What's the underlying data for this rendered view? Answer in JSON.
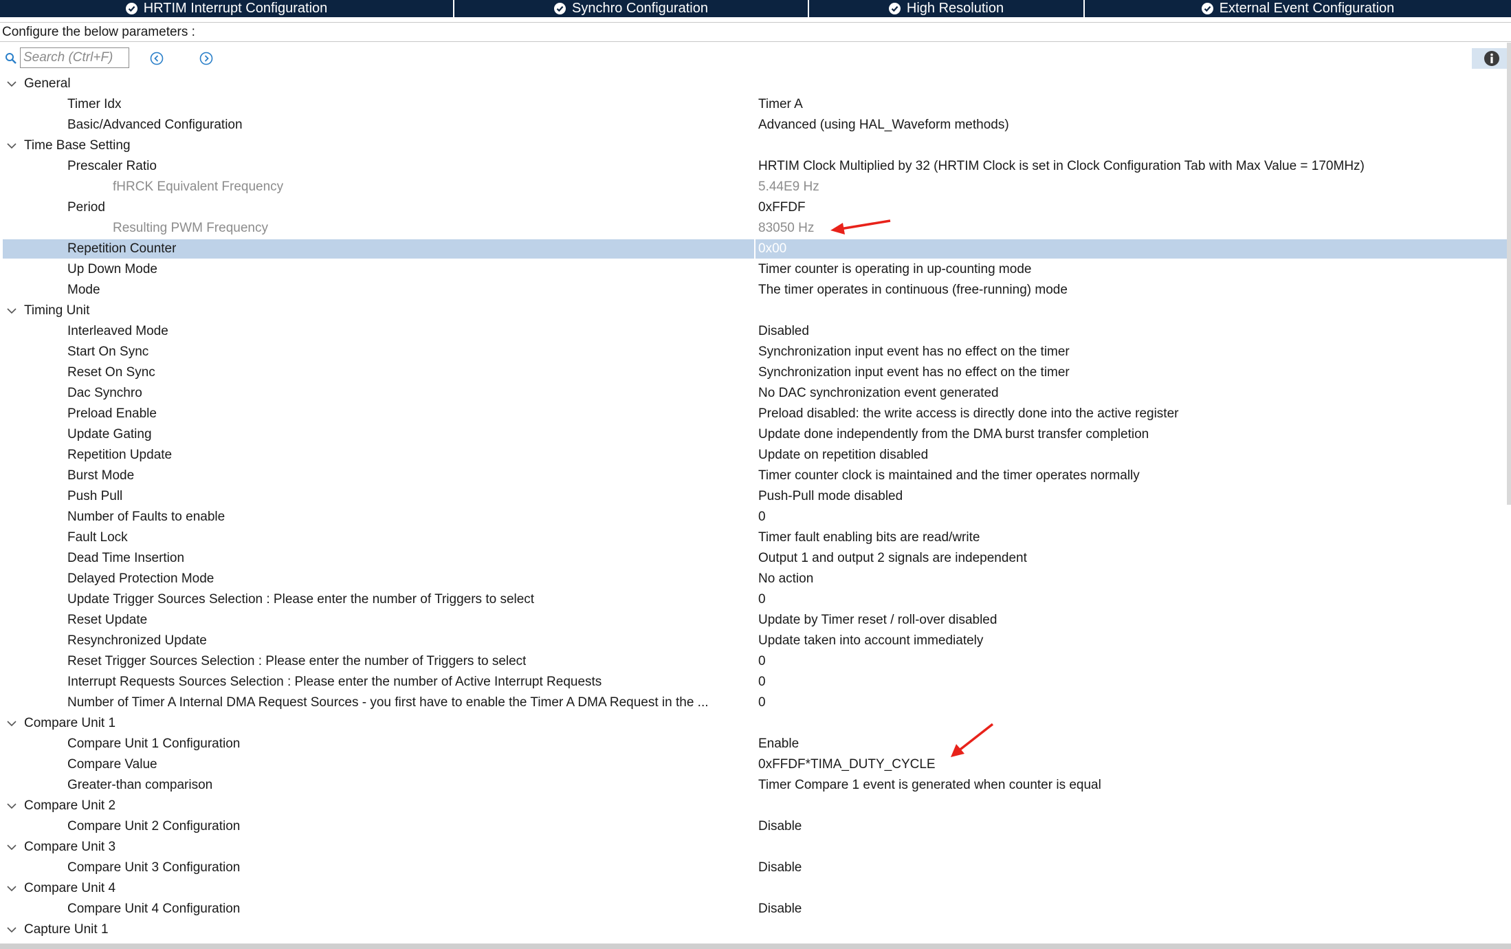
{
  "tabs": [
    {
      "label": "HRTIM Interrupt Configuration"
    },
    {
      "label": "Synchro Configuration"
    },
    {
      "label": "High Resolution"
    },
    {
      "label": "External Event Configuration"
    }
  ],
  "header": {
    "configure_label": "Configure the below parameters :"
  },
  "search": {
    "placeholder": "Search (Ctrl+F)"
  },
  "icons": {
    "tab_status": "check-circle-icon",
    "search": "search-icon",
    "prev": "chevron-left-circle-icon",
    "next": "chevron-right-circle-icon",
    "info": "info-icon",
    "category_toggle": "chevron-down-icon"
  },
  "colors": {
    "tab_background": "#0c2340",
    "selection": "#bed2e8",
    "dimmed_text": "#8c8c8c",
    "annotation_arrow": "#e8221a"
  },
  "tree": {
    "general": {
      "label": "General",
      "items": [
        {
          "label": "Timer Idx",
          "value": "Timer A"
        },
        {
          "label": "Basic/Advanced Configuration",
          "value": "Advanced (using HAL_Waveform methods)"
        }
      ]
    },
    "time_base": {
      "label": "Time Base Setting",
      "items": [
        {
          "label": "Prescaler Ratio",
          "value": "HRTIM Clock Multiplied by 32 (HRTIM Clock is set in Clock Configuration Tab with Max Value = 170MHz)"
        },
        {
          "label": "fHRCK Equivalent Frequency",
          "value": "5.44E9 Hz"
        },
        {
          "label": "Period",
          "value": "0xFFDF"
        },
        {
          "label": "Resulting PWM Frequency",
          "value": "83050 Hz"
        },
        {
          "label": "Repetition Counter",
          "value": "0x00"
        },
        {
          "label": "Up Down Mode",
          "value": "Timer counter is operating in up-counting mode"
        },
        {
          "label": "Mode",
          "value": "The timer operates in continuous (free-running) mode"
        }
      ]
    },
    "timing_unit": {
      "label": "Timing Unit",
      "items": [
        {
          "label": "Interleaved Mode",
          "value": "Disabled"
        },
        {
          "label": "Start On Sync",
          "value": "Synchronization input event has no effect on the timer"
        },
        {
          "label": "Reset On Sync",
          "value": "Synchronization input event has no effect on the timer"
        },
        {
          "label": "Dac Synchro",
          "value": "No DAC synchronization event generated"
        },
        {
          "label": "Preload Enable",
          "value": "Preload disabled: the write access is directly done into the active register"
        },
        {
          "label": "Update Gating",
          "value": "Update done independently from the DMA burst transfer completion"
        },
        {
          "label": "Repetition Update",
          "value": "Update on repetition disabled"
        },
        {
          "label": "Burst Mode",
          "value": "Timer counter clock is maintained and the timer operates normally"
        },
        {
          "label": "Push Pull",
          "value": "Push-Pull mode disabled"
        },
        {
          "label": "Number of Faults to enable",
          "value": "0"
        },
        {
          "label": "Fault Lock",
          "value": "Timer fault enabling bits are read/write"
        },
        {
          "label": "Dead Time Insertion",
          "value": "Output 1 and output 2 signals are independent"
        },
        {
          "label": "Delayed Protection Mode",
          "value": "No action"
        },
        {
          "label": "Update Trigger Sources Selection : Please enter the number of Triggers to select",
          "value": "0"
        },
        {
          "label": "Reset Update",
          "value": "Update by Timer reset / roll-over disabled"
        },
        {
          "label": "Resynchronized Update",
          "value": "Update taken into account immediately"
        },
        {
          "label": "Reset Trigger Sources Selection : Please enter the number of Triggers to select",
          "value": "0"
        },
        {
          "label": "Interrupt Requests Sources Selection : Please enter the number of Active Interrupt Requests",
          "value": "0"
        },
        {
          "label": "Number of Timer A Internal DMA Request Sources  - you first have to enable the Timer A DMA Request in the ...",
          "value": "0"
        }
      ]
    },
    "compare_unit_1": {
      "label": "Compare Unit 1",
      "items": [
        {
          "label": "Compare Unit 1 Configuration",
          "value": "Enable"
        },
        {
          "label": "Compare Value",
          "value": "0xFFDF*TIMA_DUTY_CYCLE"
        },
        {
          "label": "Greater-than comparison",
          "value": "Timer Compare 1 event is generated when counter is equal"
        }
      ]
    },
    "compare_unit_2": {
      "label": "Compare Unit 2",
      "items": [
        {
          "label": "Compare Unit 2 Configuration",
          "value": "Disable"
        }
      ]
    },
    "compare_unit_3": {
      "label": "Compare Unit 3",
      "items": [
        {
          "label": "Compare Unit 3 Configuration",
          "value": "Disable"
        }
      ]
    },
    "compare_unit_4": {
      "label": "Compare Unit 4",
      "items": [
        {
          "label": "Compare Unit 4 Configuration",
          "value": "Disable"
        }
      ]
    },
    "capture_unit_1": {
      "label": "Capture Unit 1"
    }
  }
}
